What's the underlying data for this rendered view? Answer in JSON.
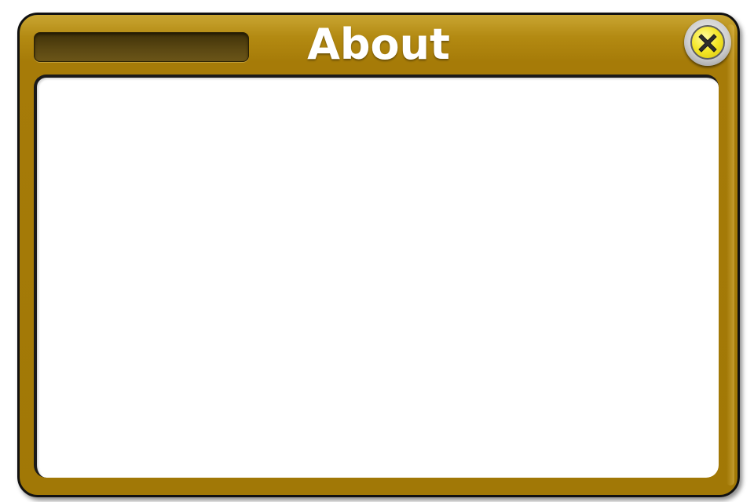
{
  "dialog": {
    "title": "About",
    "close_icon": "close-icon",
    "content_text": ""
  },
  "colors": {
    "frame": "#a67b08",
    "frame_highlight": "#c9a532",
    "title_slot": "#5a4712",
    "close_button": "#f4e626",
    "panel": "#ffffff",
    "title_text": "#ffffff"
  }
}
